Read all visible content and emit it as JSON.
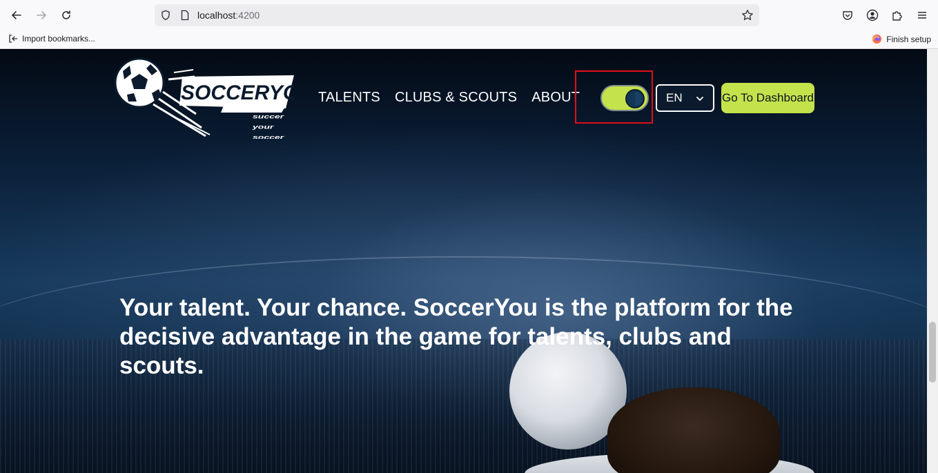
{
  "browser": {
    "url_host": "localhost",
    "url_port": ":4200",
    "bookmarks": {
      "import_label": "Import bookmarks...",
      "finish_label": "Finish setup"
    }
  },
  "header": {
    "logo": {
      "brand": "SOCCERYOU",
      "tagline_1": "succer",
      "tagline_2": "your",
      "tagline_3": "soccer"
    },
    "nav": [
      {
        "label": "TALENTS"
      },
      {
        "label": "CLUBS & SCOUTS"
      },
      {
        "label": "ABOUT"
      }
    ],
    "theme_toggle": {
      "state": "dark",
      "on": true
    },
    "language": {
      "selected": "EN"
    },
    "dashboard_button": "Go To Dashboard"
  },
  "hero": {
    "line_1": "Your talent. Your chance. SoccerYou is the platform for the",
    "line_2": "decisive advantage in the game for talents, clubs and",
    "line_3": "scouts."
  },
  "colors": {
    "accent": "#c4e24b",
    "highlight": "#e0101a",
    "navy": "#133656"
  }
}
